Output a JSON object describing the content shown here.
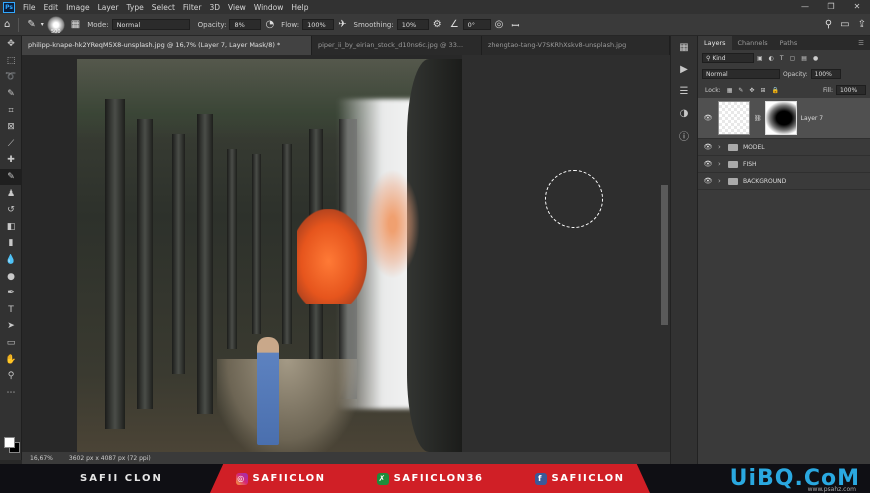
{
  "menubar": {
    "app_icon": "Ps",
    "items": [
      "File",
      "Edit",
      "Image",
      "Layer",
      "Type",
      "Select",
      "Filter",
      "3D",
      "View",
      "Window",
      "Help"
    ]
  },
  "options": {
    "brush_size": "500",
    "mode_label": "Mode:",
    "mode": "Normal",
    "opacity_label": "Opacity:",
    "opacity": "8%",
    "flow_label": "Flow:",
    "flow": "100%",
    "smoothing_label": "Smoothing:",
    "smoothing": "10%",
    "angle": "0°"
  },
  "tabs": [
    {
      "label": "philipp-knape-hk2YReqM5X8-unsplash.jpg @ 16,7% (Layer 7, Layer Mask/8) *",
      "active": true
    },
    {
      "label": "piper_ii_by_eirian_stock_d10ns6c.jpg @ 33...",
      "active": false
    },
    {
      "label": "zhengtao-tang-V7SKRhXskv8-unsplash.jpg",
      "active": false
    }
  ],
  "status": {
    "zoom": "16,67%",
    "doc_info": "3602 px x 4087 px (72 ppi)"
  },
  "layers_panel": {
    "tabs": [
      "Layers",
      "Channels",
      "Paths"
    ],
    "kind": "Kind",
    "blend": "Normal",
    "opacity_label": "Opacity:",
    "opacity": "100%",
    "lock_label": "Lock:",
    "fill_label": "Fill:",
    "fill": "100%",
    "layers": [
      {
        "name": "Layer 7",
        "selected": true
      },
      {
        "name": "MODEL"
      },
      {
        "name": "FISH"
      },
      {
        "name": "BACKGROUND"
      }
    ]
  },
  "banner": {
    "left": "SAFII CLON",
    "instagram": "SAFIICLON",
    "other": "SAFIICLON36",
    "facebook": "SAFIICLON",
    "brand": "UiBQ.CoM",
    "brand_sub": "www.psahz.com"
  },
  "colors": {
    "accent": "#31a8ff",
    "banner_red": "#d01f26",
    "brand_blue": "#2aa8e0"
  }
}
